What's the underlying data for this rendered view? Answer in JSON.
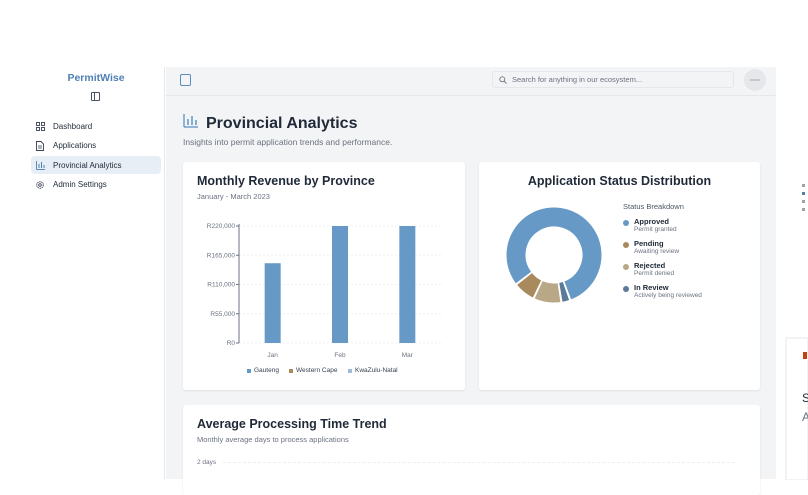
{
  "sidebar": {
    "brand": "PermitWise",
    "items": [
      {
        "label": "Dashboard",
        "icon": "grid-icon",
        "active": false
      },
      {
        "label": "Applications",
        "icon": "document-icon",
        "active": false
      },
      {
        "label": "Provincial Analytics",
        "icon": "bar-chart-icon",
        "active": true
      },
      {
        "label": "Admin Settings",
        "icon": "gear-icon",
        "active": false
      }
    ]
  },
  "topbar": {
    "search_placeholder": "Search for anything in our ecosystem..."
  },
  "page": {
    "title": "Provincial Analytics",
    "subtitle": "Insights into permit application trends and performance."
  },
  "revenue_card": {
    "title": "Monthly Revenue by Province",
    "subtitle": "January - March 2023"
  },
  "status_card": {
    "title": "Application Status Distribution",
    "breakdown_title": "Status Breakdown",
    "statuses": [
      {
        "label": "Approved",
        "desc": "Permit granted",
        "color": "#6799c6"
      },
      {
        "label": "Pending",
        "desc": "Awaiting review",
        "color": "#a88a5c"
      },
      {
        "label": "Rejected",
        "desc": "Permit denied",
        "color": "#b9a888"
      },
      {
        "label": "In Review",
        "desc": "Actively being reviewed",
        "color": "#5b7a99"
      }
    ]
  },
  "trend_card": {
    "title": "Average Processing Time Trend",
    "subtitle": "Monthly average days to process applications",
    "first_tick": "2 days"
  },
  "colors": {
    "accent": "#6799c6",
    "brand": "#4f7fb3"
  },
  "chart_data": [
    {
      "type": "bar",
      "categories": [
        "Jan",
        "Feb",
        "Mar"
      ],
      "series": [
        {
          "name": "Gauteng",
          "values": [
            150000,
            232000,
            274000
          ],
          "color": "#6799c6"
        },
        {
          "name": "Western Cape",
          "values": [
            0,
            0,
            0
          ],
          "color": "#a88a5c"
        },
        {
          "name": "KwaZulu-Natal",
          "values": [
            0,
            0,
            0
          ],
          "color": "#9dbcd9"
        }
      ],
      "yticks": [
        "R0",
        "R55,000",
        "R110,000",
        "R165,000",
        "R220,000"
      ],
      "ylim": [
        0,
        220000
      ],
      "legend": "bottom",
      "grid": true
    },
    {
      "type": "pie",
      "donut": true,
      "labels": [
        "Approved",
        "In Review",
        "Rejected",
        "Pending"
      ],
      "values": [
        80,
        3,
        9.5,
        7.5
      ],
      "colors": [
        "#6799c6",
        "#5b7a99",
        "#b9a888",
        "#a88a5c"
      ]
    }
  ]
}
